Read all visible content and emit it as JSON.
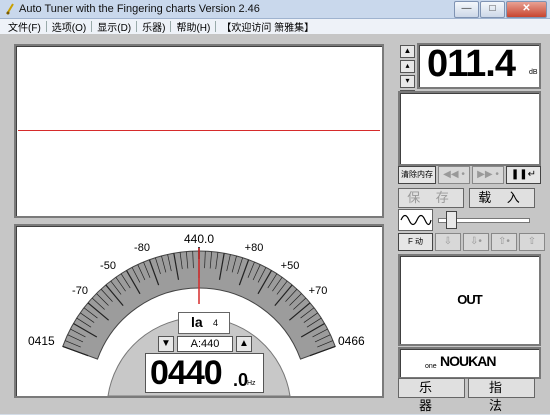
{
  "window": {
    "title": "Auto Tuner with the Fingering charts  Version 2.46",
    "buttons": {
      "minimize": "—",
      "maximize": "□",
      "close": "✕"
    }
  },
  "menu": [
    "文件(F)",
    "选项(O)",
    "显示(D)",
    "乐器)",
    "帮助(H)",
    "【欢迎访问 箫雅集】"
  ],
  "meter": {
    "center_freq": "440.0",
    "scale_labels": [
      "-80",
      "-50",
      "-70",
      "+80",
      "+50",
      "+70"
    ],
    "low_freq": "0415",
    "high_freq": "0466",
    "needle_cents": 0,
    "note": "la",
    "octave": "4",
    "a_ref": "A:440",
    "freq_int": "0440",
    "freq_dec": ".0",
    "freq_unit": "Hz"
  },
  "level": {
    "value": "011.4",
    "unit": "dB"
  },
  "controls": {
    "clear_memory": "清除内存",
    "rew": "◀◀ •",
    "fwd": "▶▶ •",
    "pause": "❚❚↵",
    "save": "保 存",
    "load": "载 入",
    "fix_label": "F 动"
  },
  "display": {
    "out": "OUT",
    "small": "one",
    "noukan": "NOUKAN"
  },
  "bottom": {
    "instrument": "乐 器",
    "fingering": "指 法"
  }
}
